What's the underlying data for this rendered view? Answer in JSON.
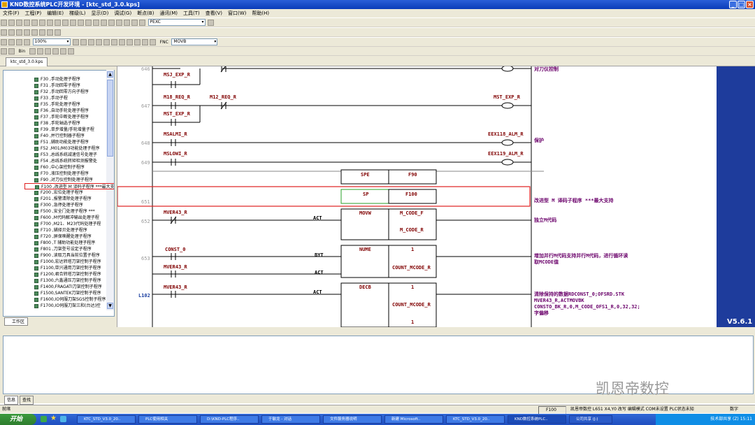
{
  "window": {
    "title": "KND数控系统PLC开发环境 - [ktc_std_3.0.kps]",
    "minimize": "_",
    "restore": "□",
    "close": "×"
  },
  "menu": [
    "文件(F)",
    "工程(P)",
    "编辑(E)",
    "梯级(L)",
    "显示(D)",
    "调试(G)",
    "断点(B)",
    "通讯(M)",
    "工具(T)",
    "查看(V)",
    "窗口(W)",
    "帮助(H)"
  ],
  "toolbar": {
    "search_value": "PEXC",
    "zoom_value": "100%",
    "fnc_label": "FNC",
    "fnc_value": "MOVB",
    "bin_label": "Bin"
  },
  "doctab": {
    "label": "ktc_std_3.0.kps"
  },
  "tree": {
    "items": [
      "F30 ,手动处理子程序",
      "F31 ,手动回零子程序",
      "F32 ,手动回零方向子程序",
      "F33 ,手动子程",
      "F35 ,手轮处理子程序",
      "F36 ,自动手轮处理子程序",
      "F37 ,手轮中断处理子程序",
      "F38 ,手轮轴选子程序",
      "F39 ,单步增量/手轮增量子程",
      "F40 ,并行控制器子程序",
      "F51 ,辅助功能处理子程序",
      "F52 ,M01/M03功能处理子程序",
      "F53 ,总线系统减速信号处理子",
      "F54 ,总线系统转矩检测报警处",
      "F60 ,中心架控制子程序",
      "F70 ,液压控制处理子程序",
      "F90 ,对刀仪控制处理子程序",
      "F100 ,改进型 M 译码子程序 ***最大支持M00~M4000***",
      "F200 ,宏位处理子程序",
      "F201 ,报警清除处理子程序",
      "F300 ,急停处理子程序",
      "F500 ,安全门处理子程序 ***",
      "F600 ,M代码解冲输出处理子程",
      "F700 ,M21、M23代码处理子程",
      "F710 ,辅择贝处理子程序",
      "F720 ,屏保唤醒处理子程序",
      "F800 ,T 辅助功能处理子程序",
      "F801 ,刀架型号设定子程序",
      "F900 ,读取刀具当前位置子程序",
      "F1000,宏达转塔刀架控制子程序",
      "F1100,亚兴通用刀架控制子程序",
      "F1200,君合转塔刀架控制子程序",
      "F1300,六鑫通压刀架控制子程序",
      "F1400,FRAGATI刀架控制子程序",
      "F1500,SANTEK刀架控制子程序",
      "F1600,IO伺服刀架SGS控制子程序",
      "F1700,IO伺服刀架三和(台达)控"
    ],
    "bottom_tab": "工作区"
  },
  "ladder": {
    "rungs": [
      {
        "num": "646",
        "inputs": [
          "MSJ_EXP_R"
        ],
        "comment": "对刀仪控制"
      },
      {
        "num": "647",
        "inputs": [
          "M18_REQ_R",
          "M12_REQ_R",
          "MST_EXP_R"
        ],
        "coil": "MST_EXP_R"
      },
      {
        "num": "648",
        "inputs": [
          "MSALMI_R"
        ],
        "coil": "EEX118_ALM_R",
        "comment": "保护"
      },
      {
        "num": "649",
        "inputs": [
          "MSLOWI_R"
        ],
        "coil": "EEX119_ALM_R"
      },
      {
        "num": "650",
        "fn": "SPE",
        "param": "F90"
      },
      {
        "num": "651",
        "fn": "SP",
        "param": "F100",
        "comment": "改进型 M 译码子程序 ***最大支持"
      },
      {
        "num": "652",
        "inputs": [
          "MVER43_R"
        ],
        "act": "ACT",
        "fn": "MOVW",
        "params": [
          "M_CODE_F",
          "M_CODE_R"
        ],
        "comment": "独立M代码"
      },
      {
        "num": "653",
        "inputs": [
          "CONST_0",
          "MVER43_R"
        ],
        "byt": "BYT",
        "act": "ACT",
        "fn": "NUME",
        "params": [
          "1",
          "COUNT_MCODE_R"
        ],
        "comment": "增加并行M代码支持并行M代码，进行循环读取MCODE值"
      },
      {
        "num": "L102",
        "inputs": [
          "MVER43_R"
        ],
        "act": "ACT",
        "fn": "DECB",
        "params": [
          "1",
          "COUNT_MCODE_R",
          "1"
        ],
        "comment": "清除保持的数据RDCONST_0;OFSRD.STK MVER43_R,ACTMOVBK CONSTO_BK_R,0,M_CODE_OFS1_R,0,32,32;字偏移"
      }
    ]
  },
  "version": "V5.6.1",
  "bottom_tabs": [
    "信息",
    "查找"
  ],
  "status": {
    "ready": "就绪",
    "f": "F100",
    "ctrl": "凯恩帝数控 L651 X4,Y0 改写 编辑模式 COM未设置 PLC状态未知",
    "digit": "数字"
  },
  "taskbar": {
    "start": "开始",
    "tasks": [
      "KTC_STD_V3.0_20..",
      "PLC使用相关",
      "D:\\KND-PLC程序..",
      "于敏龙 - 对话",
      "文件服务器说明",
      "新建 Microsoft..",
      "KTC_STD_V3.0_20..",
      "KND数控系统PLC..",
      "公司共享 (J:)"
    ],
    "tray_time": "15:11",
    "tray_text": "技术部共享 (Z)"
  },
  "watermark": "凯恩帝数控"
}
